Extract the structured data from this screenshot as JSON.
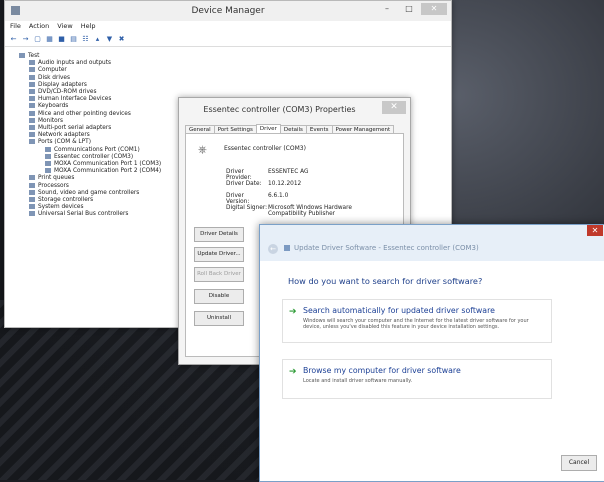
{
  "device_manager": {
    "title": "Device Manager",
    "menu": [
      "File",
      "Action",
      "View",
      "Help"
    ],
    "tree": {
      "root": "Test",
      "categories": [
        "Audio inputs and outputs",
        "Computer",
        "Disk drives",
        "Display adapters",
        "DVD/CD-ROM drives",
        "Human Interface Devices",
        "Keyboards",
        "Mice and other pointing devices",
        "Monitors",
        "Multi-port serial adapters",
        "Network adapters",
        "Ports (COM & LPT)"
      ],
      "ports": [
        "Communications Port (COM1)",
        "Essentec controller (COM3)",
        "MOXA Communication Port 1 (COM3)",
        "MOXA Communication Port 2 (COM4)"
      ],
      "more_categories": [
        "Print queues",
        "Processors",
        "Sound, video and game controllers",
        "Storage controllers",
        "System devices",
        "Universal Serial Bus controllers"
      ]
    }
  },
  "properties": {
    "title": "Essentec controller (COM3) Properties",
    "tabs": [
      "General",
      "Port Settings",
      "Driver",
      "Details",
      "Events",
      "Power Management"
    ],
    "device_name": "Essentec controller (COM3)",
    "fields": {
      "provider_label": "Driver Provider:",
      "provider_value": "ESSENTEC AG",
      "date_label": "Driver Date:",
      "date_value": "10.12.2012",
      "version_label": "Driver Version:",
      "version_value": "6.6.1.0",
      "signer_label": "Digital Signer:",
      "signer_value": "Microsoft Windows Hardware Compatibility Publisher"
    },
    "buttons": [
      "Driver Details",
      "Update Driver...",
      "Roll Back Driver",
      "Disable",
      "Uninstall"
    ]
  },
  "update": {
    "title": "Update Driver Software - Essentec controller (COM3)",
    "question": "How do you want to search for driver software?",
    "option1": {
      "heading": "Search automatically for updated driver software",
      "desc": "Windows will search your computer and the Internet for the latest driver software for your device, unless you've disabled this feature in your device installation settings."
    },
    "option2": {
      "heading": "Browse my computer for driver software",
      "desc": "Locate and install driver software manually."
    },
    "cancel": "Cancel"
  }
}
